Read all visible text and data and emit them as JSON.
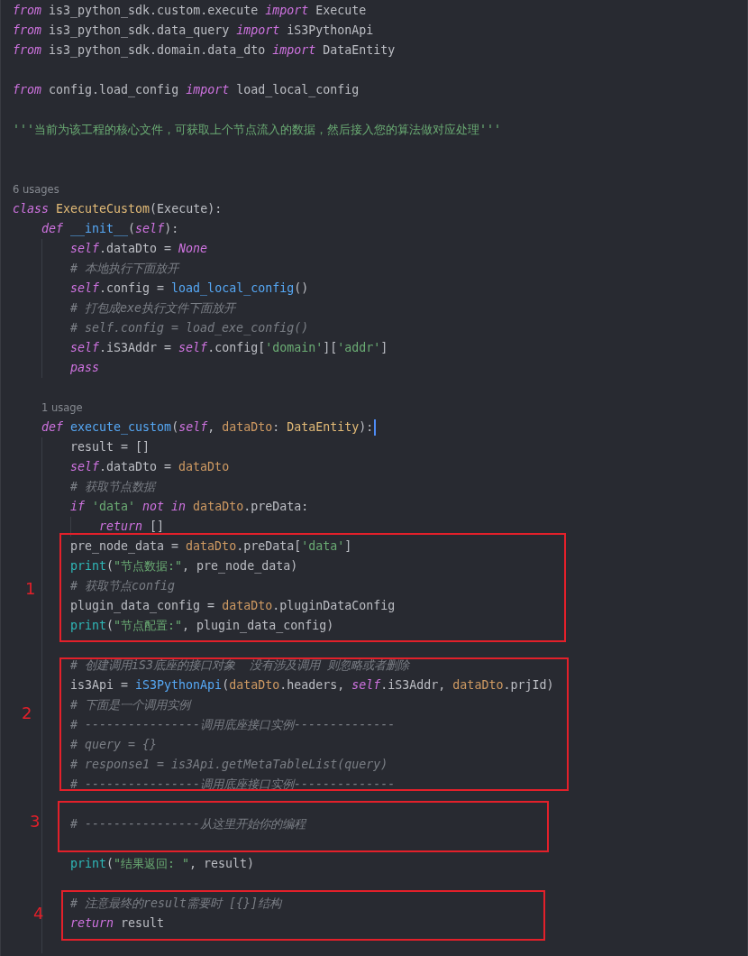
{
  "lines": [
    {
      "kind": "code",
      "tokens": [
        {
          "kind": "keyword",
          "text": "from"
        },
        {
          "kind": "plain",
          "text": " is3_python_sdk.custom.execute "
        },
        {
          "kind": "keyword",
          "text": "import"
        },
        {
          "kind": "plain",
          "text": " Execute"
        }
      ]
    },
    {
      "kind": "code",
      "tokens": [
        {
          "kind": "keyword",
          "text": "from"
        },
        {
          "kind": "plain",
          "text": " is3_python_sdk.data_query "
        },
        {
          "kind": "keyword",
          "text": "import"
        },
        {
          "kind": "plain",
          "text": " iS3PythonApi"
        }
      ]
    },
    {
      "kind": "code",
      "tokens": [
        {
          "kind": "keyword",
          "text": "from"
        },
        {
          "kind": "plain",
          "text": " is3_python_sdk.domain.data_dto "
        },
        {
          "kind": "keyword",
          "text": "import"
        },
        {
          "kind": "plain",
          "text": " DataEntity"
        }
      ]
    },
    {
      "kind": "blank"
    },
    {
      "kind": "code",
      "tokens": [
        {
          "kind": "keyword",
          "text": "from"
        },
        {
          "kind": "plain",
          "text": " config.load_config "
        },
        {
          "kind": "keyword",
          "text": "import"
        },
        {
          "kind": "plain",
          "text": " load_local_config"
        }
      ]
    },
    {
      "kind": "blank"
    },
    {
      "kind": "code",
      "tokens": [
        {
          "kind": "string",
          "text": "'''当前为该工程的核心文件，可获取上个节点流入的数据，然后接入您的算法做对应处理'''"
        }
      ]
    },
    {
      "kind": "blank"
    },
    {
      "kind": "blank"
    },
    {
      "kind": "hint",
      "text": "6 usages"
    },
    {
      "kind": "code",
      "tokens": [
        {
          "kind": "keyword",
          "text": "class"
        },
        {
          "kind": "type",
          "text": " ExecuteCustom"
        },
        {
          "kind": "plain",
          "text": "(Execute):"
        }
      ],
      "children": [
        {
          "kind": "code",
          "tokens": [
            {
              "kind": "keyword",
              "text": "def"
            },
            {
              "kind": "function",
              "text": " __init__"
            },
            {
              "kind": "plain",
              "text": "("
            },
            {
              "kind": "keyword",
              "text": "self"
            },
            {
              "kind": "plain",
              "text": "):"
            }
          ],
          "children": [
            {
              "kind": "code",
              "tokens": [
                {
                  "kind": "keyword",
                  "text": "self"
                },
                {
                  "kind": "plain",
                  "text": ".dataDto = "
                },
                {
                  "kind": "keyword",
                  "text": "None"
                }
              ]
            },
            {
              "kind": "code",
              "tokens": [
                {
                  "kind": "comment",
                  "text": "# 本地执行下面放开"
                }
              ]
            },
            {
              "kind": "code",
              "tokens": [
                {
                  "kind": "keyword",
                  "text": "self"
                },
                {
                  "kind": "plain",
                  "text": ".config = "
                },
                {
                  "kind": "function",
                  "text": "load_local_config"
                },
                {
                  "kind": "plain",
                  "text": "()"
                }
              ]
            },
            {
              "kind": "code",
              "tokens": [
                {
                  "kind": "comment",
                  "text": "# 打包成exe执行文件下面放开"
                }
              ]
            },
            {
              "kind": "code",
              "tokens": [
                {
                  "kind": "comment",
                  "text": "# self.config = load_exe_config()"
                }
              ]
            },
            {
              "kind": "code",
              "tokens": [
                {
                  "kind": "keyword",
                  "text": "self"
                },
                {
                  "kind": "plain",
                  "text": ".iS3Addr = "
                },
                {
                  "kind": "keyword",
                  "text": "self"
                },
                {
                  "kind": "plain",
                  "text": ".config["
                },
                {
                  "kind": "string",
                  "text": "'domain'"
                },
                {
                  "kind": "plain",
                  "text": "]["
                },
                {
                  "kind": "string",
                  "text": "'addr'"
                },
                {
                  "kind": "plain",
                  "text": "]"
                }
              ]
            },
            {
              "kind": "code",
              "tokens": [
                {
                  "kind": "keyword",
                  "text": "pass"
                }
              ]
            }
          ]
        },
        {
          "kind": "blank"
        },
        {
          "kind": "hint",
          "text": "1 usage"
        },
        {
          "kind": "code",
          "cursor": true,
          "tokens": [
            {
              "kind": "keyword",
              "text": "def"
            },
            {
              "kind": "function",
              "text": " execute_custom"
            },
            {
              "kind": "plain",
              "text": "("
            },
            {
              "kind": "keyword",
              "text": "self"
            },
            {
              "kind": "plain",
              "text": ", "
            },
            {
              "kind": "variable",
              "text": "dataDto"
            },
            {
              "kind": "plain",
              "text": ": "
            },
            {
              "kind": "type",
              "text": "DataEntity"
            },
            {
              "kind": "plain",
              "text": "):"
            }
          ],
          "children": [
            {
              "kind": "code",
              "tokens": [
                {
                  "kind": "plain",
                  "text": "result = []"
                }
              ]
            },
            {
              "kind": "code",
              "tokens": [
                {
                  "kind": "keyword",
                  "text": "self"
                },
                {
                  "kind": "plain",
                  "text": ".dataDto = "
                },
                {
                  "kind": "variable",
                  "text": "dataDto"
                }
              ]
            },
            {
              "kind": "code",
              "tokens": [
                {
                  "kind": "comment",
                  "text": "# 获取节点数据"
                }
              ]
            },
            {
              "kind": "code",
              "tokens": [
                {
                  "kind": "keyword",
                  "text": "if"
                },
                {
                  "kind": "string",
                  "text": " 'data'"
                },
                {
                  "kind": "keyword",
                  "text": " not in"
                },
                {
                  "kind": "variable",
                  "text": " dataDto"
                },
                {
                  "kind": "plain",
                  "text": ".preData:"
                }
              ],
              "children": [
                {
                  "kind": "code",
                  "tokens": [
                    {
                      "kind": "keyword",
                      "text": "return"
                    },
                    {
                      "kind": "plain",
                      "text": " []"
                    }
                  ]
                }
              ]
            },
            {
              "kind": "code",
              "tokens": [
                {
                  "kind": "plain",
                  "text": "pre_node_data = "
                },
                {
                  "kind": "variable",
                  "text": "dataDto"
                },
                {
                  "kind": "plain",
                  "text": ".preData["
                },
                {
                  "kind": "string",
                  "text": "'data'"
                },
                {
                  "kind": "plain",
                  "text": "]"
                }
              ]
            },
            {
              "kind": "code",
              "tokens": [
                {
                  "kind": "builtin",
                  "text": "print"
                },
                {
                  "kind": "plain",
                  "text": "("
                },
                {
                  "kind": "string",
                  "text": "\"节点数据:\""
                },
                {
                  "kind": "plain",
                  "text": ", pre_node_data)"
                }
              ]
            },
            {
              "kind": "code",
              "tokens": [
                {
                  "kind": "comment",
                  "text": "# 获取节点config"
                }
              ]
            },
            {
              "kind": "code",
              "tokens": [
                {
                  "kind": "plain",
                  "text": "plugin_data_config = "
                },
                {
                  "kind": "variable",
                  "text": "dataDto"
                },
                {
                  "kind": "plain",
                  "text": ".pluginDataConfig"
                }
              ]
            },
            {
              "kind": "code",
              "tokens": [
                {
                  "kind": "builtin",
                  "text": "print"
                },
                {
                  "kind": "plain",
                  "text": "("
                },
                {
                  "kind": "string",
                  "text": "\"节点配置:\""
                },
                {
                  "kind": "plain",
                  "text": ", plugin_data_config)"
                }
              ]
            },
            {
              "kind": "blank"
            },
            {
              "kind": "code",
              "tokens": [
                {
                  "kind": "comment",
                  "text": "# 创建调用iS3底座的接口对象  没有涉及调用 则忽略或者删除"
                }
              ]
            },
            {
              "kind": "code",
              "tokens": [
                {
                  "kind": "plain",
                  "text": "is3Api = "
                },
                {
                  "kind": "function",
                  "text": "iS3PythonApi"
                },
                {
                  "kind": "plain",
                  "text": "("
                },
                {
                  "kind": "variable",
                  "text": "dataDto"
                },
                {
                  "kind": "plain",
                  "text": ".headers, "
                },
                {
                  "kind": "keyword",
                  "text": "self"
                },
                {
                  "kind": "plain",
                  "text": ".iS3Addr, "
                },
                {
                  "kind": "variable",
                  "text": "dataDto"
                },
                {
                  "kind": "plain",
                  "text": ".prjId)"
                }
              ]
            },
            {
              "kind": "code",
              "tokens": [
                {
                  "kind": "comment",
                  "text": "# 下面是一个调用实例"
                }
              ]
            },
            {
              "kind": "code",
              "tokens": [
                {
                  "kind": "comment",
                  "text": "# ----------------调用底座接口实例--------------"
                }
              ]
            },
            {
              "kind": "code",
              "tokens": [
                {
                  "kind": "comment",
                  "text": "# query = {}"
                }
              ]
            },
            {
              "kind": "code",
              "tokens": [
                {
                  "kind": "comment",
                  "text": "# response1 = is3Api.getMetaTableList(query)"
                }
              ]
            },
            {
              "kind": "code",
              "tokens": [
                {
                  "kind": "comment",
                  "text": "# ----------------调用底座接口实例--------------"
                }
              ]
            },
            {
              "kind": "blank"
            },
            {
              "kind": "code",
              "tokens": [
                {
                  "kind": "comment",
                  "text": "# ----------------从这里开始你的编程"
                }
              ]
            },
            {
              "kind": "blank"
            },
            {
              "kind": "code",
              "tokens": [
                {
                  "kind": "builtin",
                  "text": "print"
                },
                {
                  "kind": "plain",
                  "text": "("
                },
                {
                  "kind": "string",
                  "text": "\"结果返回: \""
                },
                {
                  "kind": "plain",
                  "text": ", result)"
                }
              ]
            },
            {
              "kind": "blank"
            },
            {
              "kind": "code",
              "tokens": [
                {
                  "kind": "comment",
                  "text": "# 注意最终的result需要时 [{}]结构"
                }
              ]
            },
            {
              "kind": "code",
              "tokens": [
                {
                  "kind": "keyword",
                  "text": "return"
                },
                {
                  "kind": "plain",
                  "text": " result"
                }
              ]
            },
            {
              "kind": "blank"
            }
          ]
        }
      ]
    }
  ],
  "annotations": [
    {
      "label": "1"
    },
    {
      "label": "2"
    },
    {
      "label": "3"
    },
    {
      "label": "4"
    }
  ]
}
